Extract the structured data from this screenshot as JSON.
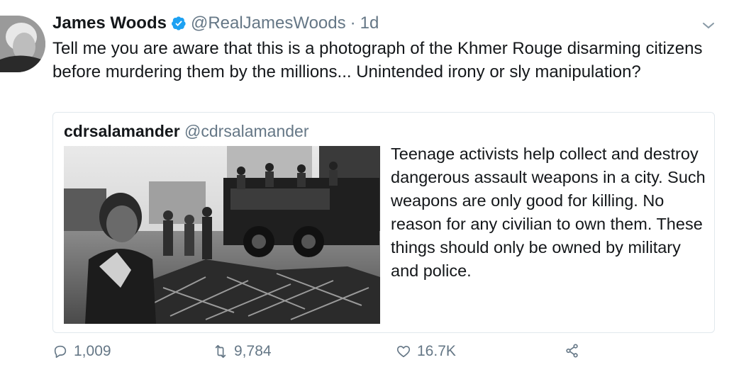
{
  "tweet": {
    "author_name": "James Woods",
    "author_handle": "@RealJamesWoods",
    "separator": "·",
    "time": "1d",
    "text": "Tell me you are aware that this is a photograph of the Khmer Rouge disarming citizens before murdering them by the millions... Unintended irony or sly manipulation?"
  },
  "quoted_tweet": {
    "author_name": "cdrsalamander",
    "author_handle": "@cdrsalamander",
    "text": "Teenage activists help collect and destroy dangerous assault weapons in a city. Such weapons are only good for killing. No reason for any civilian to own them. These things should only be owned by military and police."
  },
  "actions": {
    "replies": "1,009",
    "retweets": "9,784",
    "likes": "16.7K"
  },
  "colors": {
    "text": "#14171a",
    "secondary": "#657786",
    "verified": "#1da1f2",
    "border": "#e1e8ed"
  },
  "icons": [
    "verified-badge-icon",
    "chevron-down-icon",
    "reply-icon",
    "retweet-icon",
    "like-icon",
    "share-icon"
  ]
}
